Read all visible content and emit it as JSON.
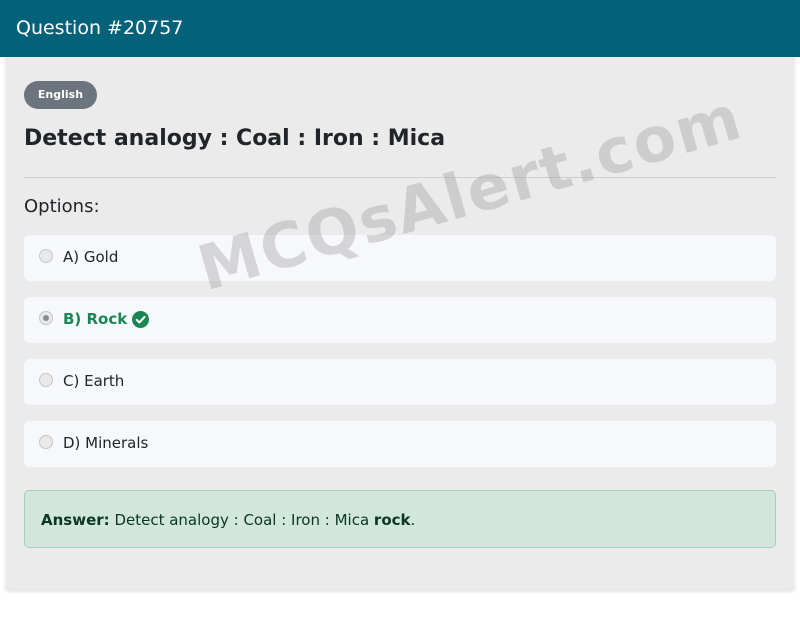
{
  "header": {
    "title": "Question #20757"
  },
  "language_badge": "English",
  "question": "Detect analogy : Coal : Iron : Mica",
  "options_label": "Options:",
  "options": [
    {
      "label": "A) Gold",
      "selected": false,
      "correct": false
    },
    {
      "label": "B) Rock",
      "selected": true,
      "correct": true
    },
    {
      "label": "C) Earth",
      "selected": false,
      "correct": false
    },
    {
      "label": "D) Minerals",
      "selected": false,
      "correct": false
    }
  ],
  "answer": {
    "prefix": "Answer:",
    "text": "Detect analogy : Coal : Iron : Mica",
    "highlight": "rock",
    "suffix": "."
  },
  "watermark": "MCQsAlert.com",
  "colors": {
    "header_bg": "#03617a",
    "correct": "#198754",
    "answer_bg": "#d1e7dd",
    "badge_bg": "#6c757d"
  },
  "icons": {
    "correct_marker": "check-circle-icon"
  }
}
